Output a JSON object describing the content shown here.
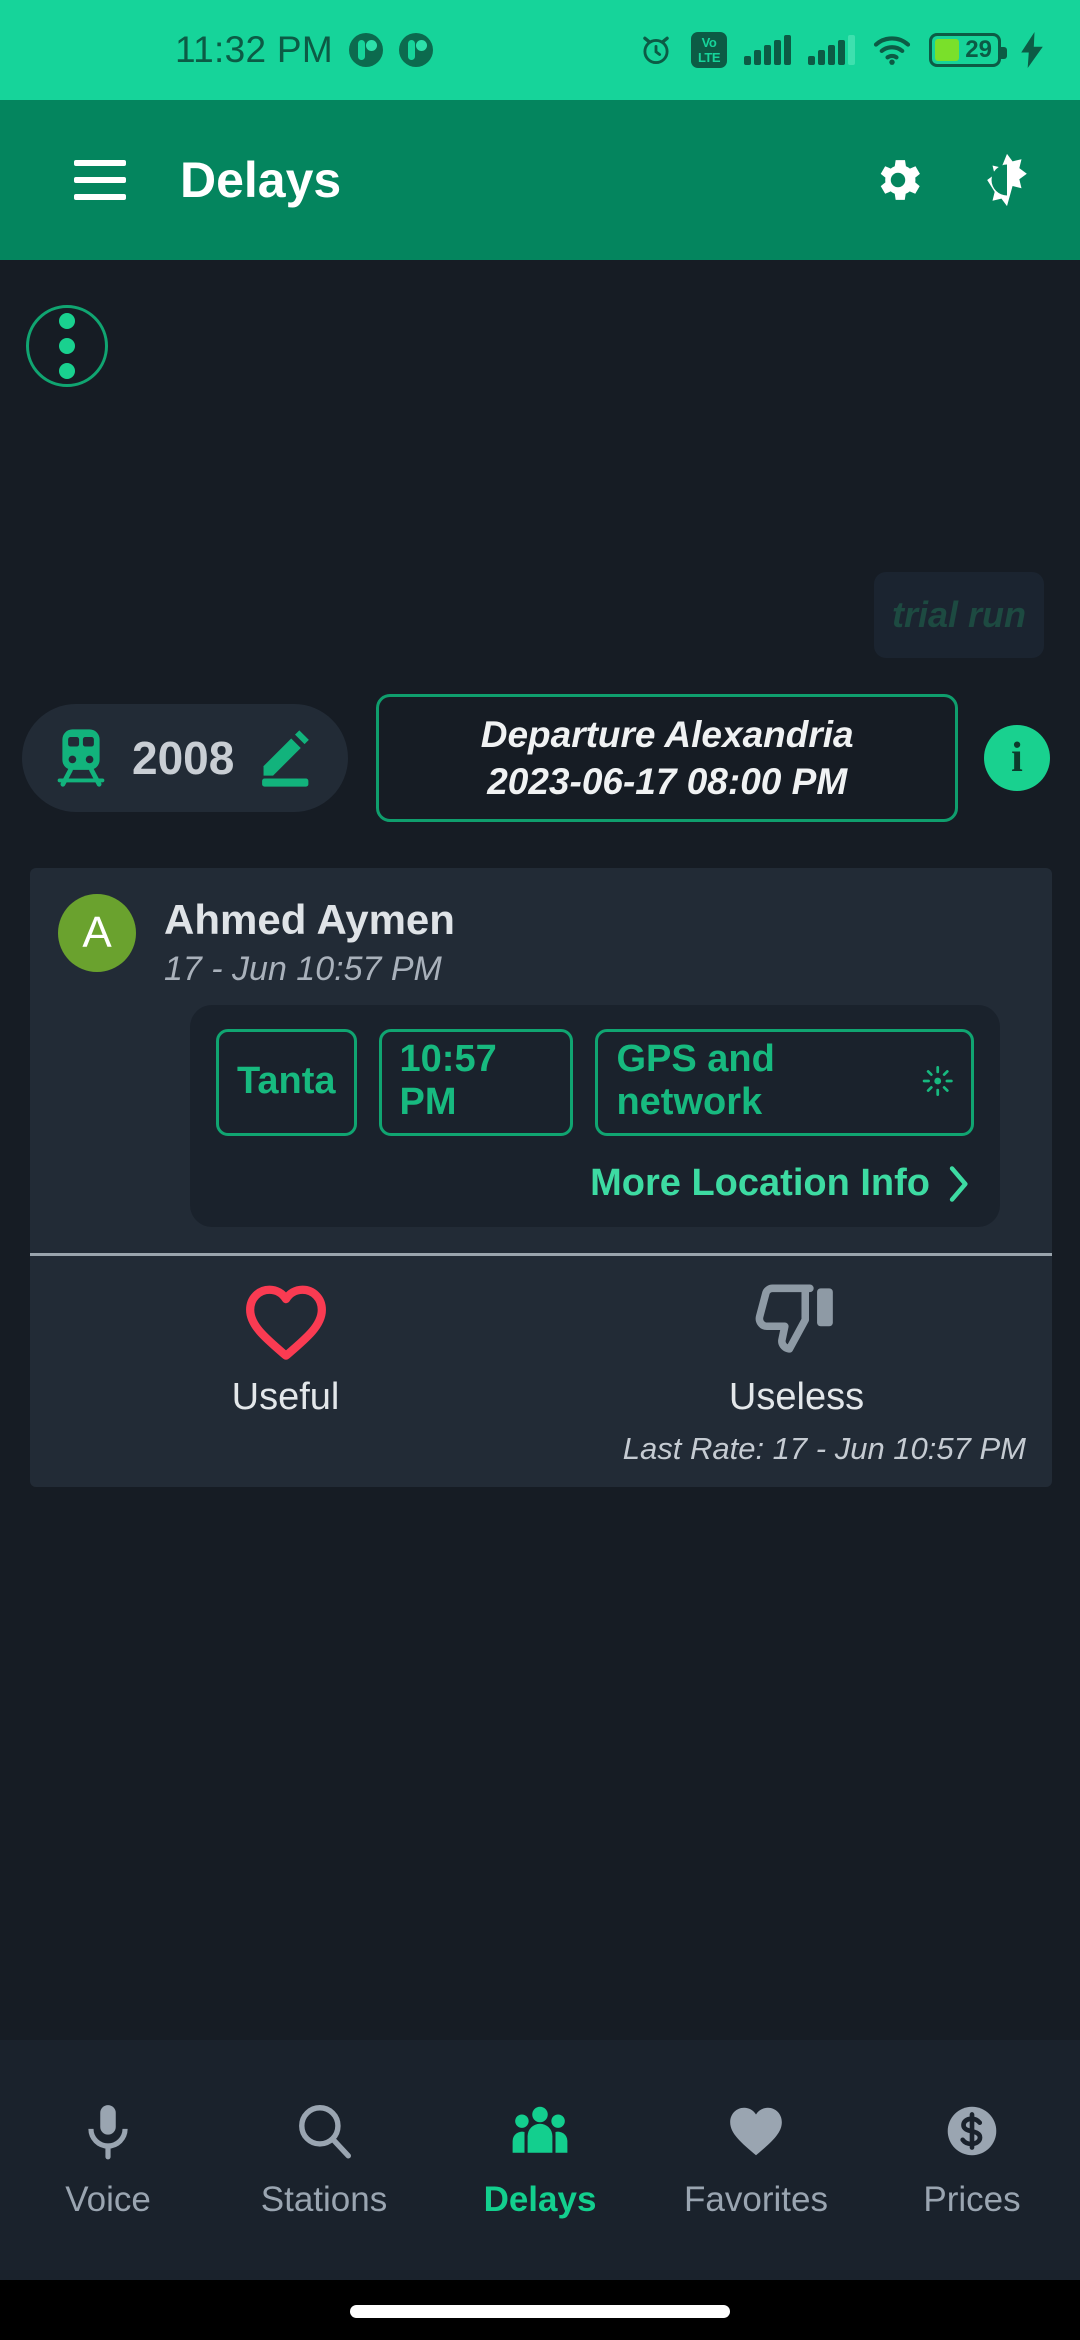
{
  "status_bar": {
    "time": "11:32 PM",
    "notification_icons": [
      "notification-dot-icon",
      "notification-dot-icon"
    ],
    "alarm_icon": "alarm-icon",
    "volte_label_top": "Vo",
    "volte_label_bottom": "LTE",
    "signal_icons": [
      "signal-bars-icon",
      "signal-bars-icon"
    ],
    "wifi_icon": "wifi-icon",
    "battery_percent": "29",
    "charging_icon": "charging-bolt-icon",
    "bg_color": "#16d49a"
  },
  "app_bar": {
    "menu_icon": "hamburger-menu-icon",
    "title": "Delays",
    "settings_icon": "gear-icon",
    "theme_toggle_icon": "dark-mode-icon",
    "bg_color": "#04855e"
  },
  "toolbar": {
    "overflow_icon": "three-dots-vertical-icon",
    "trial_run_watermark": "trial run"
  },
  "trip": {
    "train_icon": "train-icon",
    "train_number": "2008",
    "edit_icon": "pencil-edit-icon",
    "departure_title": "Departure Alexandria",
    "departure_datetime": "2023-06-17 08:00 PM",
    "info_icon": "i",
    "accent_color": "#19d18f"
  },
  "report": {
    "avatar_initial": "A",
    "avatar_color": "#6aa22e",
    "reporter_name": "Ahmed Aymen",
    "reported_at": "17 - Jun 10:57 PM",
    "chips": [
      {
        "label": "Tanta",
        "icon": null
      },
      {
        "label": "10:57 PM",
        "icon": null
      },
      {
        "label": "GPS and network",
        "icon": "location-searching-icon"
      }
    ],
    "more_location_link": "More Location Info",
    "more_location_chevron": "chevron-right-icon",
    "rating": {
      "useful_label": "Useful",
      "useful_icon": "heart-outline-icon",
      "useful_color": "#fa3b52",
      "useless_label": "Useless",
      "useless_icon": "thumb-down-icon",
      "useless_color": "#8e9aa5",
      "last_rate": "Last Rate: 17 - Jun 10:57 PM"
    }
  },
  "bottom_nav": {
    "items": [
      {
        "label": "Voice",
        "icon": "microphone-icon",
        "active": false
      },
      {
        "label": "Stations",
        "icon": "search-icon",
        "active": false
      },
      {
        "label": "Delays",
        "icon": "people-group-icon",
        "active": true
      },
      {
        "label": "Favorites",
        "icon": "heart-filled-icon",
        "active": false
      },
      {
        "label": "Prices",
        "icon": "dollar-coin-icon",
        "active": false
      }
    ],
    "active_color": "#13cf8e",
    "inactive_color": "#9aa5b1"
  }
}
